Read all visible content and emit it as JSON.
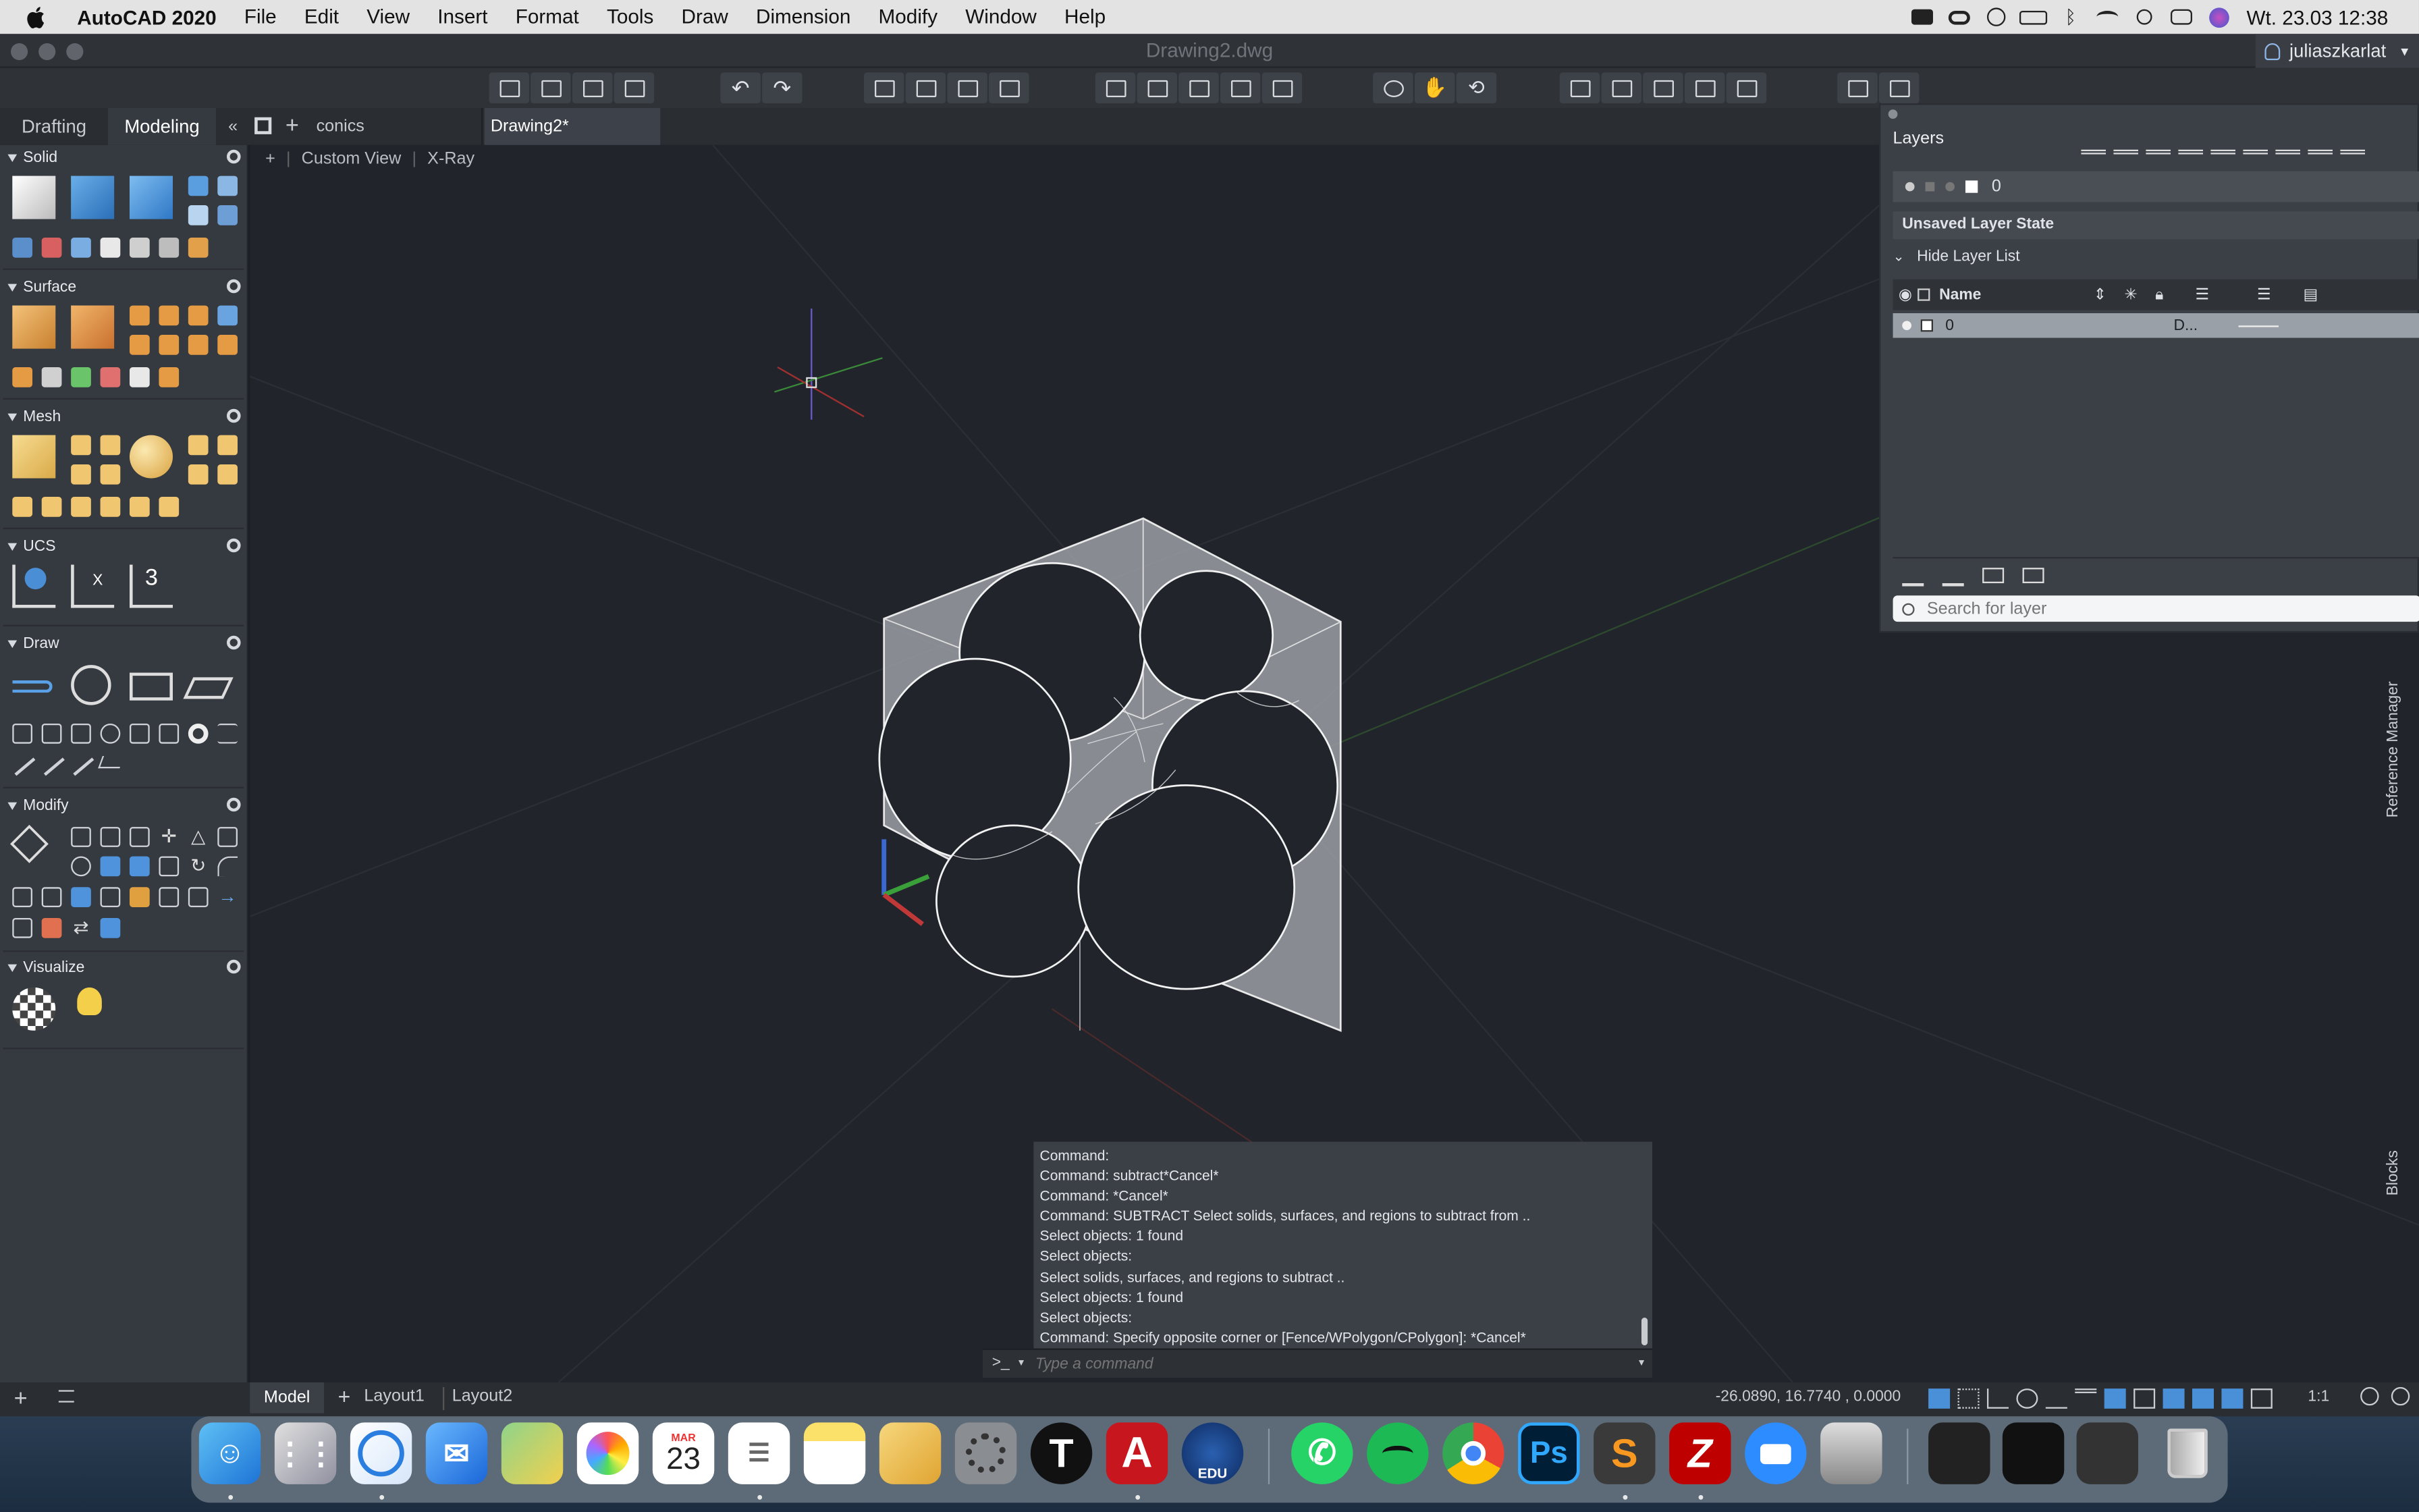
{
  "menubar": {
    "app_name": "AutoCAD 2020",
    "items": [
      "File",
      "Edit",
      "View",
      "Insert",
      "Format",
      "Tools",
      "Draw",
      "Dimension",
      "Modify",
      "Window",
      "Help"
    ],
    "clock": "Wt. 23.03  12:38"
  },
  "window": {
    "title": "Drawing2.dwg",
    "user": "juliaszkarlat"
  },
  "ribbon_tabs": {
    "drafting": "Drafting",
    "modeling": "Modeling"
  },
  "file_tabs": {
    "conics": "conics",
    "drawing2": "Drawing2*"
  },
  "viewport": {
    "label_plus": "+",
    "view": "Custom View",
    "visual_style": "X-Ray"
  },
  "palette": {
    "sections": [
      "Solid",
      "Surface",
      "Mesh",
      "UCS",
      "Draw",
      "Modify",
      "Visualize"
    ]
  },
  "layers": {
    "title": "Layers",
    "current_layer": "0",
    "layer_state": "Unsaved Layer State",
    "hide_list": "Hide Layer List",
    "col_name": "Name",
    "row_name": "0",
    "row_linetype": "D...",
    "search_placeholder": "Search for layer"
  },
  "side_labels": {
    "reference": "Reference Manager",
    "blocks": "Blocks"
  },
  "command": {
    "lines": [
      "Command:",
      "Command: subtract*Cancel*",
      "Command: *Cancel*",
      "Command: SUBTRACT Select solids, surfaces, and regions to subtract from ..",
      "Select objects: 1 found",
      "Select objects:",
      "Select solids, surfaces, and regions to subtract ..",
      "Select objects: 1 found",
      "Select objects:",
      "Command: Specify opposite corner or [Fence/WPolygon/CPolygon]: *Cancel*"
    ],
    "placeholder": "Type a command",
    "prompt": ">_"
  },
  "layout_tabs": {
    "model": "Model",
    "layout1": "Layout1",
    "layout2": "Layout2"
  },
  "status": {
    "coords": "-26.0890, 16.7740 , 0.0000",
    "scale": "1:1"
  },
  "dock": {
    "calendar_month": "MAR",
    "calendar_day": "23",
    "ps": "Ps",
    "edu": "EDU"
  },
  "colors": {
    "accent": "#4a90d9",
    "viewport_bg": "#21252b",
    "panel": "#353a40"
  }
}
